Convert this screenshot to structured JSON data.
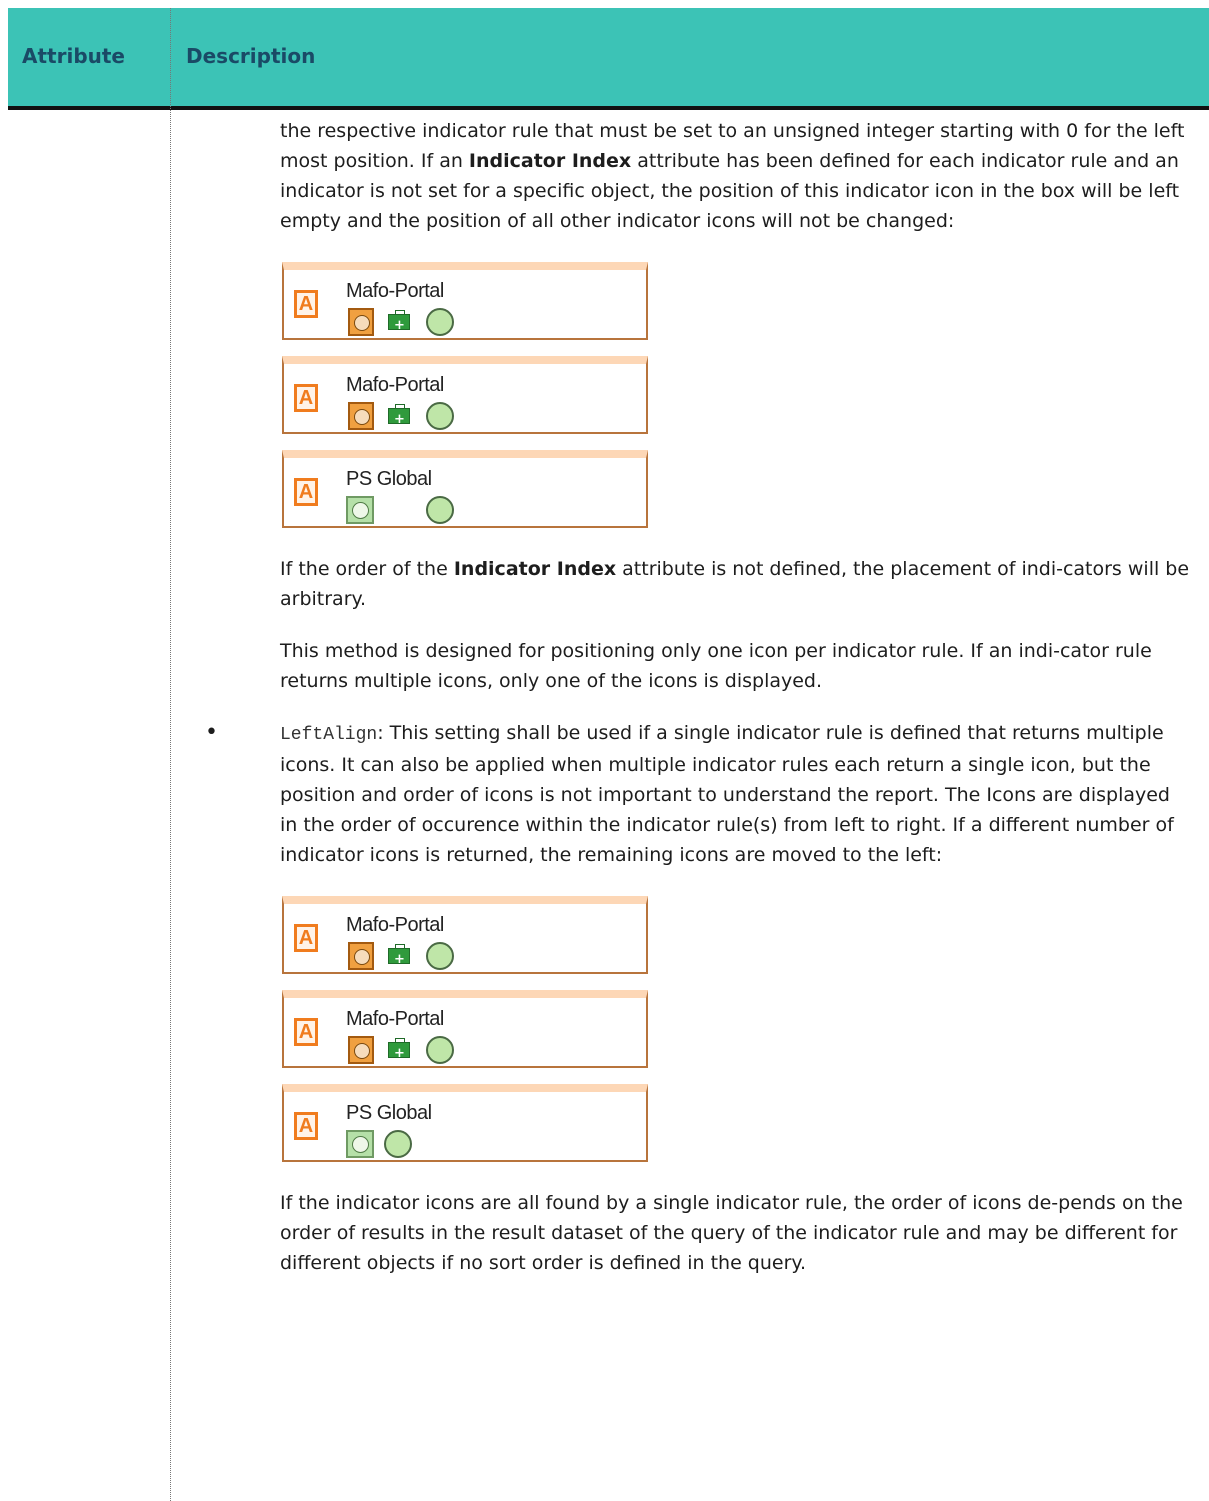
{
  "header": {
    "col_attribute": "Attribute",
    "col_description": "Description"
  },
  "para1": {
    "t1": "the respective indicator rule that must be set to an unsigned integer starting with 0 for the left most position. If an ",
    "b1": "Indicator Index",
    "t2": " attribute has been defined for each indicator rule and an indicator is not set for a specific object, the position of this indicator icon in the box will be left empty and the position of all other indicator icons will not be changed:"
  },
  "figure1": {
    "objects": [
      {
        "name": "Mafo-Portal",
        "icons": [
          "sad-face-icon",
          "briefcase-icon",
          "circle-icon"
        ]
      },
      {
        "name": "Mafo-Portal",
        "icons": [
          "sad-face-icon",
          "briefcase-icon",
          "circle-icon"
        ]
      },
      {
        "name": "PS Global",
        "icons": [
          "happy-face-icon",
          "circle-icon"
        ]
      }
    ]
  },
  "para2": {
    "t1": "If the order of the ",
    "b1": "Indicator Index",
    "t2": " attribute is not defined, the placement of indi-cators will be arbitrary."
  },
  "para3": "This method is designed for positioning only one icon per indicator rule. If an indi-cator rule returns multiple icons, only one of the icons is displayed.",
  "bullet": {
    "code": "LeftAlign",
    "text": ": This setting shall be used if a single indicator rule is defined that returns multiple icons. It can also be applied when multiple indicator rules each return a single icon, but the position and order of icons is not important to understand the report. The Icons are displayed in the order of occurence within the indicator rule(s) from left to right. If a different number of indicator icons is returned, the remaining icons are moved to the left:"
  },
  "figure2": {
    "objects": [
      {
        "name": "Mafo-Portal",
        "icons": [
          "sad-face-icon",
          "briefcase-icon",
          "circle-icon"
        ]
      },
      {
        "name": "Mafo-Portal",
        "icons": [
          "sad-face-icon",
          "briefcase-icon",
          "circle-icon"
        ]
      },
      {
        "name": "PS Global",
        "icons": [
          "happy-face-icon",
          "circle-icon"
        ]
      }
    ]
  },
  "para4": "If the indicator icons are all found by a single indicator rule, the order of icons de-pends on the order of results in the result dataset of the query of the indicator rule and may be different for different objects if no sort order is defined in the query.",
  "colors": {
    "header_bg": "#3cc3b6",
    "header_text": "#1a4a66",
    "object_border": "#b8743c",
    "object_top": "#fdd7b6"
  }
}
